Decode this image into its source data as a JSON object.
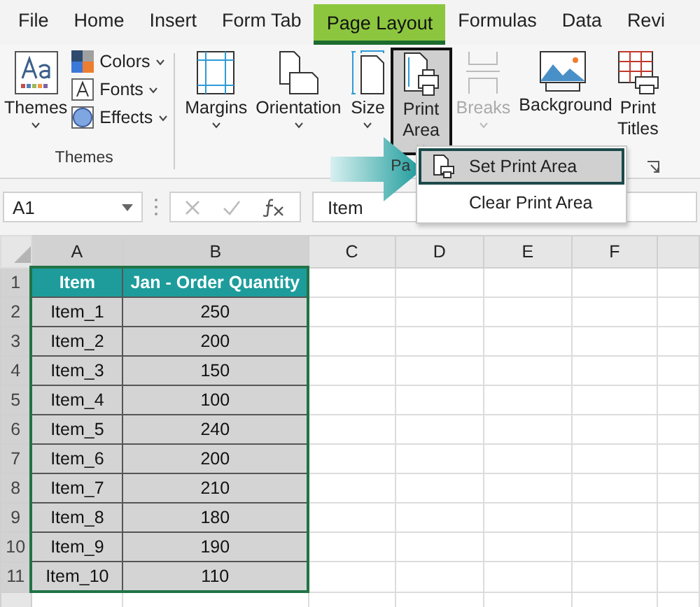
{
  "tabs": [
    {
      "label": "File",
      "selected": false
    },
    {
      "label": "Home",
      "selected": false
    },
    {
      "label": "Insert",
      "selected": false
    },
    {
      "label": "Form Tab",
      "selected": false
    },
    {
      "label": "Page Layout",
      "selected": true
    },
    {
      "label": "Formulas",
      "selected": false
    },
    {
      "label": "Data",
      "selected": false
    },
    {
      "label": "Revi",
      "selected": false
    }
  ],
  "ribbon": {
    "themes_group": {
      "label": "Themes",
      "themes_button": {
        "label": "Themes"
      },
      "options": [
        {
          "kind": "colors",
          "label": "Colors"
        },
        {
          "kind": "fonts",
          "label": "Fonts"
        },
        {
          "kind": "effects",
          "label": "Effects"
        }
      ]
    },
    "page_setup_group": {
      "label": "Pa",
      "buttons": [
        {
          "kind": "margins",
          "label": "Margins",
          "pressed": false,
          "disabled": false
        },
        {
          "kind": "orientation",
          "label": "Orientation",
          "pressed": false,
          "disabled": false
        },
        {
          "kind": "size",
          "label": "Size",
          "pressed": false,
          "disabled": false
        },
        {
          "kind": "print-area",
          "label": "Print Area",
          "pressed": true,
          "disabled": false
        },
        {
          "kind": "breaks",
          "label": "Breaks",
          "pressed": false,
          "disabled": true
        },
        {
          "kind": "background",
          "label": "Background",
          "pressed": false,
          "disabled": false
        },
        {
          "kind": "print-titles",
          "label": "Print Titles",
          "pressed": false,
          "disabled": false
        }
      ]
    }
  },
  "print_area_menu": [
    {
      "label": "Set Print Area",
      "selected": true
    },
    {
      "label": "Clear Print Area",
      "selected": false
    }
  ],
  "formula_bar": {
    "name_box": "A1",
    "value": "Item"
  },
  "table": {
    "columns": [
      {
        "label": "A",
        "selected": true
      },
      {
        "label": "B",
        "selected": true
      },
      {
        "label": "C",
        "selected": false
      },
      {
        "label": "D",
        "selected": false
      },
      {
        "label": "E",
        "selected": false
      },
      {
        "label": "F",
        "selected": false
      }
    ],
    "rows": [
      {
        "number": "1",
        "selected": true,
        "kind": "header",
        "cells": [
          "Item",
          "Jan - Order Quantity"
        ]
      },
      {
        "number": "2",
        "selected": true,
        "kind": "data",
        "cells": [
          "Item_1",
          "250"
        ]
      },
      {
        "number": "3",
        "selected": true,
        "kind": "data",
        "cells": [
          "Item_2",
          "200"
        ]
      },
      {
        "number": "4",
        "selected": true,
        "kind": "data",
        "cells": [
          "Item_3",
          "150"
        ]
      },
      {
        "number": "5",
        "selected": true,
        "kind": "data",
        "cells": [
          "Item_4",
          "100"
        ]
      },
      {
        "number": "6",
        "selected": true,
        "kind": "data",
        "cells": [
          "Item_5",
          "240"
        ]
      },
      {
        "number": "7",
        "selected": true,
        "kind": "data",
        "cells": [
          "Item_6",
          "200"
        ]
      },
      {
        "number": "8",
        "selected": true,
        "kind": "data",
        "cells": [
          "Item_7",
          "210"
        ]
      },
      {
        "number": "9",
        "selected": true,
        "kind": "data",
        "cells": [
          "Item_8",
          "180"
        ]
      },
      {
        "number": "10",
        "selected": true,
        "kind": "data",
        "cells": [
          "Item_9",
          "190"
        ]
      },
      {
        "number": "11",
        "selected": true,
        "kind": "data",
        "cells": [
          "Item_10",
          "110"
        ]
      }
    ]
  }
}
